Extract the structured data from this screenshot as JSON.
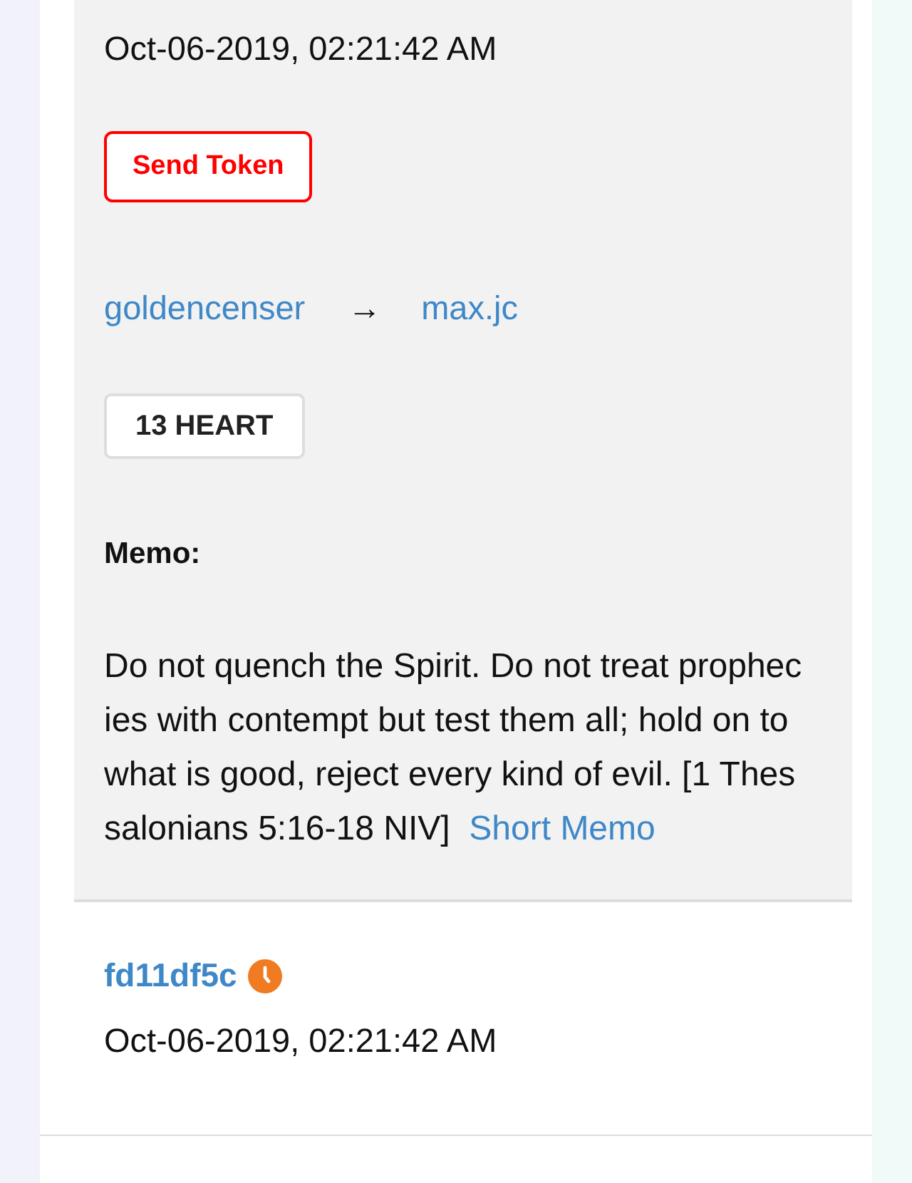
{
  "transfer": {
    "timestamp": "Oct-06-2019, 02:21:42 AM",
    "send_button": "Send Token",
    "from": "goldencenser",
    "arrow": "→",
    "to": "max.jc",
    "amount": "13 HEART",
    "memo_label": "Memo:",
    "memo": "Do not quench the Spirit. Do not treat prophecies with contempt but test them all; hold on to what is good, reject every kind of evil. [1 Thessalonians 5:16-18 NIV]",
    "memo_toggle": "Short Memo"
  },
  "next": {
    "id": "fd11df5c",
    "pending": true,
    "timestamp": "Oct-06-2019, 02:21:42 AM"
  }
}
